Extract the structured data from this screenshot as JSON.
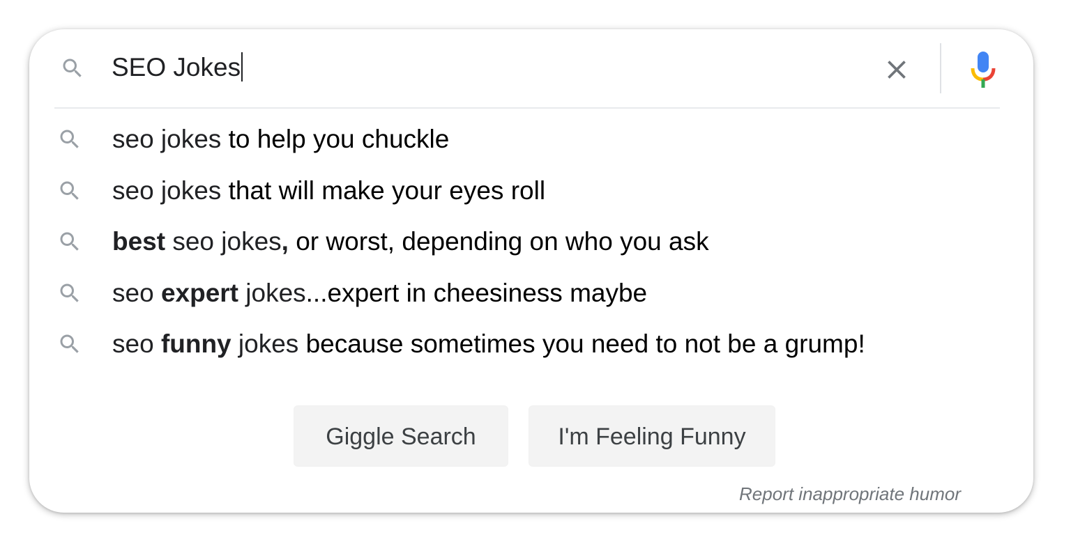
{
  "search": {
    "query": "SEO Jokes",
    "clear_icon": "close-icon",
    "search_icon": "search-icon",
    "mic_icon": "microphone-icon"
  },
  "suggestions": [
    {
      "parts": [
        {
          "text": "seo jokes ",
          "style": "muted"
        },
        {
          "text": "to help you chuckle",
          "style": "plain"
        }
      ]
    },
    {
      "parts": [
        {
          "text": "seo jokes ",
          "style": "muted"
        },
        {
          "text": "that will make your eyes roll",
          "style": "plain"
        }
      ]
    },
    {
      "parts": [
        {
          "text": "best",
          "style": "bold"
        },
        {
          "text": " seo jokes",
          "style": "muted"
        },
        {
          "text": ",",
          "style": "bold"
        },
        {
          "text": " or worst, depending on who you ask",
          "style": "plain"
        }
      ]
    },
    {
      "parts": [
        {
          "text": "seo ",
          "style": "muted"
        },
        {
          "text": "expert",
          "style": "bold"
        },
        {
          "text": " jokes",
          "style": "muted"
        },
        {
          "text": "...expert in cheesiness maybe",
          "style": "plain"
        }
      ]
    },
    {
      "parts": [
        {
          "text": "seo ",
          "style": "muted"
        },
        {
          "text": "funny",
          "style": "bold"
        },
        {
          "text": " jokes ",
          "style": "muted"
        },
        {
          "text": "because sometimes you need to not be a grump!",
          "style": "plain"
        }
      ]
    }
  ],
  "buttons": {
    "search_label": "Giggle Search",
    "lucky_label": "I'm Feeling Funny"
  },
  "footer": {
    "report_label": "Report inappropriate humor"
  },
  "colors": {
    "mic_blue": "#4285f4",
    "mic_red": "#ea4335",
    "mic_yellow": "#fbbc04",
    "mic_green": "#34a853",
    "icon_gray": "#9aa0a6"
  }
}
